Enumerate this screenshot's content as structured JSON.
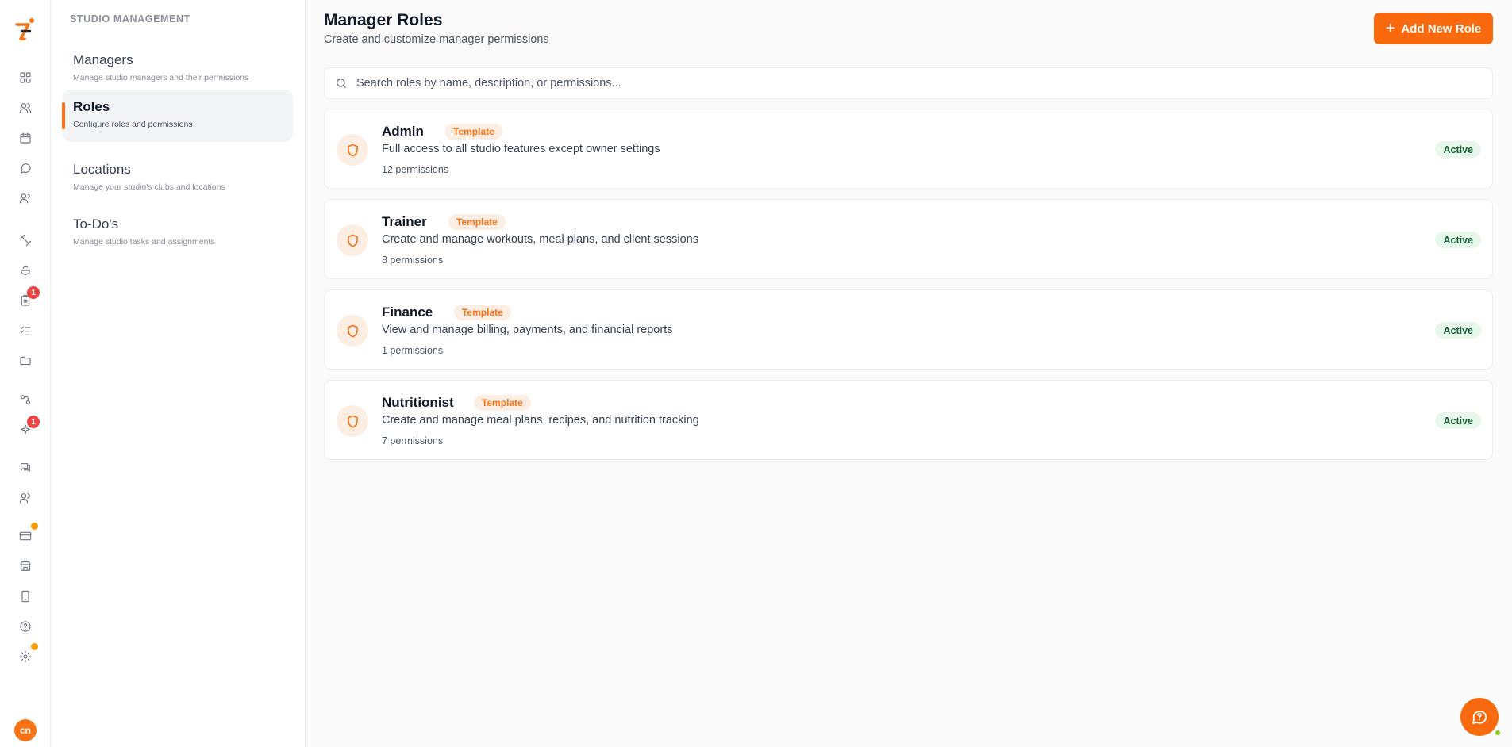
{
  "sidebar": {
    "badges": {
      "todos": "1",
      "ai": "1"
    },
    "avatar_initials": "cn"
  },
  "subnav": {
    "section_label": "STUDIO MANAGEMENT",
    "items": [
      {
        "title": "Managers",
        "desc": "Manage studio managers and their permissions"
      },
      {
        "title": "Roles",
        "desc": "Configure roles and permissions"
      },
      {
        "title": "Locations",
        "desc": "Manage your studio's clubs and locations"
      },
      {
        "title": "To-Do's",
        "desc": "Manage studio tasks and assignments"
      }
    ]
  },
  "header": {
    "title": "Manager Roles",
    "subtitle": "Create and customize manager permissions",
    "add_button_label": "Add New Role"
  },
  "search": {
    "placeholder": "Search roles by name, description, or permissions..."
  },
  "roles": [
    {
      "name": "Admin",
      "tag": "Template",
      "description": "Full access to all studio features except owner settings",
      "permissions": "12 permissions",
      "status": "Active"
    },
    {
      "name": "Trainer",
      "tag": "Template",
      "description": "Create and manage workouts, meal plans, and client sessions",
      "permissions": "8 permissions",
      "status": "Active"
    },
    {
      "name": "Finance",
      "tag": "Template",
      "description": "View and manage billing, payments, and financial reports",
      "permissions": "1 permissions",
      "status": "Active"
    },
    {
      "name": "Nutritionist",
      "tag": "Template",
      "description": "Create and manage meal plans, recipes, and nutrition tracking",
      "permissions": "7 permissions",
      "status": "Active"
    }
  ],
  "colors": {
    "accent": "#f96a0e",
    "status_active_bg": "#e7f7ec",
    "status_active_text": "#166534"
  }
}
